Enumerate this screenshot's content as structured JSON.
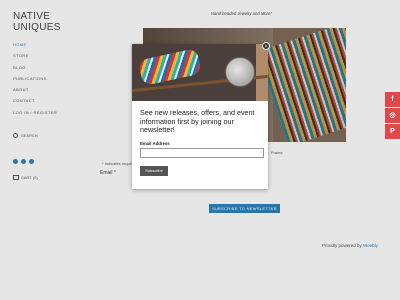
{
  "site": {
    "logo_line1": "NATIVE",
    "logo_line2": "UNIQUES",
    "tagline": "Hand beaded Jewelry and More!",
    "accent_color": "#2f7fb5"
  },
  "sidebar": {
    "nav": [
      {
        "label": "HOME",
        "active": true
      },
      {
        "label": "STORE"
      },
      {
        "label": "BLOG"
      },
      {
        "label": "PUBLICATIONS"
      },
      {
        "label": "ABOUT"
      },
      {
        "label": "CONTACT"
      },
      {
        "label": "LOG IN / REGISTER"
      }
    ],
    "search_label": "SEARCH",
    "social_icons": [
      "facebook-icon",
      "twitter-icon",
      "mail-icon"
    ],
    "cart_label": "CART (0)"
  },
  "main": {
    "frame_text": "Frame",
    "subscribe_line": "* Indicates required field",
    "email_label": "Email *",
    "newsletter_button": "SUBSCRIBE TO NEWSLETTER",
    "powered_prefix": "Proudly powered by",
    "powered_brand": "Weebly"
  },
  "share": {
    "items": [
      {
        "glyph": "f",
        "icon": "facebook-icon"
      },
      {
        "glyph": "◎",
        "icon": "instagram-icon"
      },
      {
        "glyph": "P",
        "icon": "pinterest-icon"
      }
    ],
    "color": "#e0484c"
  },
  "modal": {
    "close_glyph": "×",
    "heading": "See new releases, offers, and event information first by joining our newsletter!",
    "email_label": "Email Address",
    "email_value": "",
    "subscribe_label": "Subscribe"
  }
}
